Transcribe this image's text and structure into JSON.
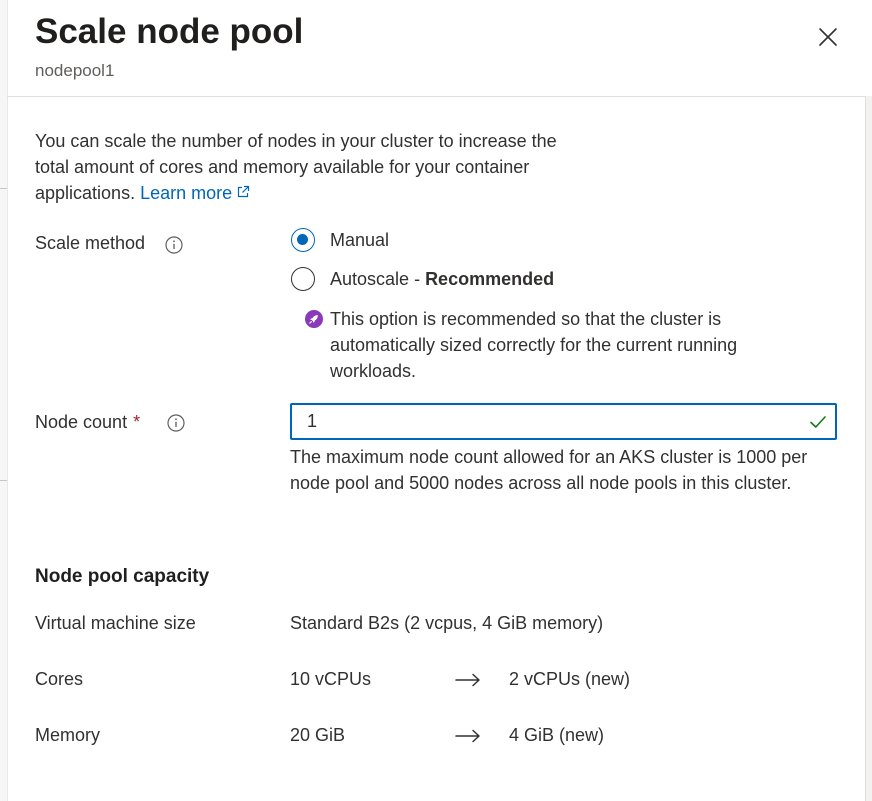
{
  "panel": {
    "title": "Scale node pool",
    "subtitle": "nodepool1"
  },
  "intro": {
    "text": "You can scale the number of nodes in your cluster to increase the total amount of cores and memory available for your container applications.",
    "link_label": "Learn more"
  },
  "scale_method": {
    "label": "Scale method",
    "options": [
      {
        "label": "Manual",
        "suffix": "",
        "bold": "",
        "selected": true
      },
      {
        "label": "Autoscale",
        "suffix": " - ",
        "bold": "Recommended",
        "selected": false
      }
    ],
    "recommendation_note": "This option is recommended so that the cluster is automatically sized correctly for the current running workloads."
  },
  "node_count": {
    "label": "Node count",
    "required_marker": "*",
    "value": "1",
    "hint": "The maximum node count allowed for an AKS cluster is 1000 per node pool and 5000 nodes across all node pools in this cluster."
  },
  "capacity": {
    "title": "Node pool capacity",
    "rows": [
      {
        "label": "Virtual machine size",
        "value": "Standard B2s (2 vcpus, 4 GiB memory)",
        "new_value": ""
      },
      {
        "label": "Cores",
        "value": "10 vCPUs",
        "new_value": "2 vCPUs (new)"
      },
      {
        "label": "Memory",
        "value": "20 GiB",
        "new_value": "4 GiB (new)"
      }
    ]
  },
  "colors": {
    "accent": "#0067b8",
    "success": "#107c10",
    "recommend": "#8a3ab9",
    "required": "#a4262c"
  },
  "icons": {
    "close": "close-icon",
    "info": "info-icon",
    "external_link": "external-link-icon",
    "recommend": "rocket-icon",
    "valid": "checkmark-icon",
    "arrow": "arrow-right-icon"
  }
}
